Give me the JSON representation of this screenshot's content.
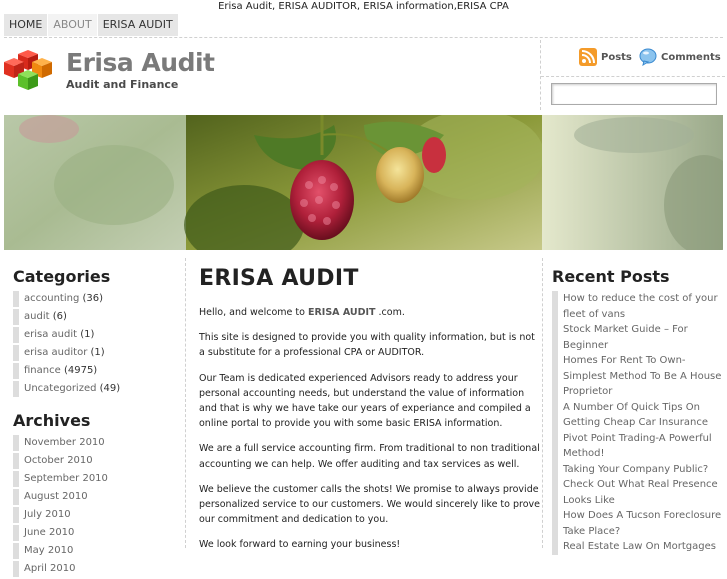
{
  "top_text": "Erisa Audit, ERISA AUDITOR, ERISA information,ERISA CPA",
  "nav": [
    "HOME",
    "ABOUT",
    "ERISA AUDIT"
  ],
  "site": {
    "title": "Erisa Audit",
    "tagline": "Audit and Finance"
  },
  "feeds": {
    "posts": "Posts",
    "comments": "Comments"
  },
  "search": {
    "value": ""
  },
  "categories": {
    "title": "Categories",
    "items": [
      {
        "label": "accounting",
        "count": "(36)"
      },
      {
        "label": "audit",
        "count": "(6)"
      },
      {
        "label": "erisa audit",
        "count": "(1)"
      },
      {
        "label": "erisa auditor",
        "count": "(1)"
      },
      {
        "label": "finance",
        "count": "(4975)"
      },
      {
        "label": "Uncategorized",
        "count": "(49)"
      }
    ]
  },
  "archives": {
    "title": "Archives",
    "items": [
      "November 2010",
      "October 2010",
      "September 2010",
      "August 2010",
      "July 2010",
      "June 2010",
      "May 2010",
      "April 2010"
    ]
  },
  "post": {
    "title": "ERISA AUDIT",
    "p1_pre": "Hello, and welcome to ",
    "p1_bold": "ERISA AUDIT",
    "p1_post": " .com.",
    "p2": "This site is designed to provide you with quality information, but is not a substitute for a professional CPA or AUDITOR.",
    "p3": "Our Team is dedicated experienced Advisors ready to address your personal accounting needs, but understand the value of information and that is why we have take our years of experiance and compiled a online portal to provide you with some basic ERISA information.",
    "p4": "We are a full service accounting firm.  From traditional to non traditional accounting we can help.  We offer auditing and tax services as well.",
    "p5": "We believe the customer calls the shots!  We promise to always provide personalized service to our customers.  We would sincerely like to prove our commitment and dedication to you.",
    "p6": "We look forward to earning your business!"
  },
  "recent": {
    "title": "Recent Posts",
    "items": [
      "How to reduce the cost of your fleet of vans",
      "Stock Market Guide – For Beginner",
      "Homes For Rent To Own- Simplest Method To Be A House Proprietor",
      "A Number Of Quick Tips On Getting Cheap Car Insurance",
      "Pivot Point Trading-A Powerful Method!",
      "Taking Your Company Public? Check Out What Real Presence Looks Like",
      "How Does A Tucson Foreclosure Take Place?",
      "Real Estate Law On Mortgages"
    ]
  }
}
